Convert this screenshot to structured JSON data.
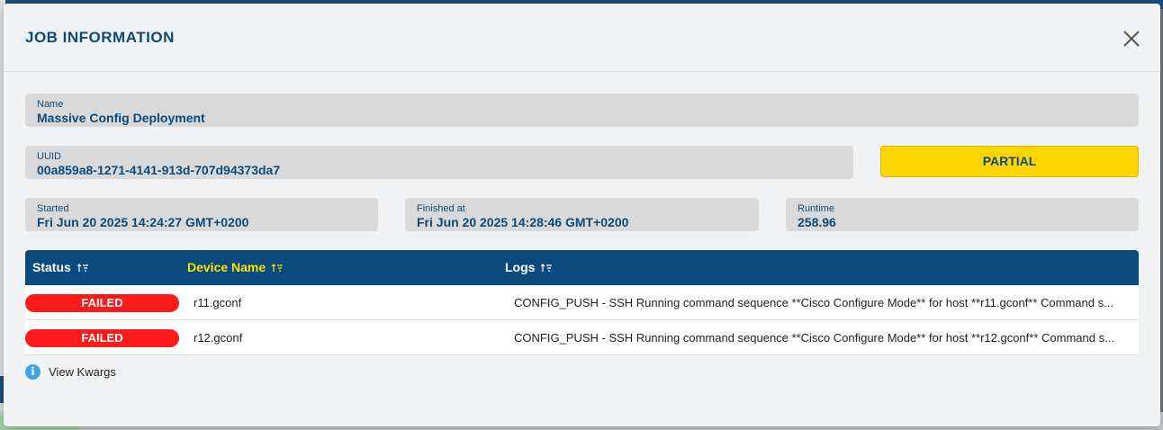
{
  "modal": {
    "title": "JOB INFORMATION"
  },
  "fields": {
    "name": {
      "label": "Name",
      "value": "Massive Config Deployment"
    },
    "uuid": {
      "label": "UUID",
      "value": "00a859a8-1271-4141-913d-707d94373da7"
    },
    "status": "PARTIAL",
    "started": {
      "label": "Started",
      "value": "Fri Jun 20 2025 14:24:27 GMT+0200"
    },
    "finished": {
      "label": "Finished at",
      "value": "Fri Jun 20 2025 14:28:46 GMT+0200"
    },
    "runtime": {
      "label": "Runtime",
      "value": "258.96"
    }
  },
  "table": {
    "columns": [
      "Status",
      "Device Name",
      "Logs"
    ],
    "rows": [
      {
        "status": "FAILED",
        "device": "r11.gconf",
        "log": "CONFIG_PUSH - SSH Running command sequence **Cisco Configure Mode** for host **r11.gconf** Command s..."
      },
      {
        "status": "FAILED",
        "device": "r12.gconf",
        "log": "CONFIG_PUSH - SSH Running command sequence **Cisco Configure Mode** for host **r12.gconf** Command s..."
      }
    ]
  },
  "kwargs": {
    "icon": "i",
    "label": "View Kwargs"
  },
  "colors": {
    "primary": "#0b4a7d",
    "partial": "#ffd500",
    "failed": "#ff1a1a",
    "active_sort": "#ffe000"
  }
}
